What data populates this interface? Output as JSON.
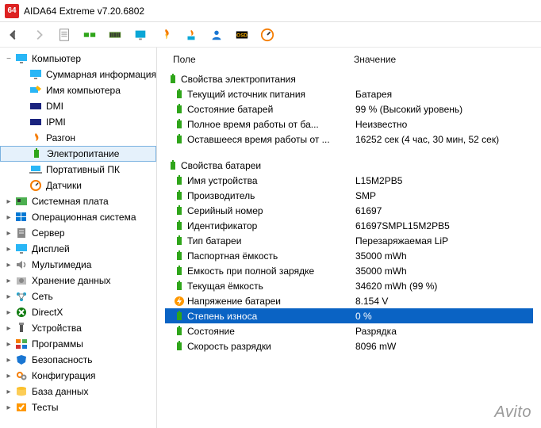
{
  "app": {
    "icon_text": "64",
    "title": "AIDA64 Extreme v7.20.6802"
  },
  "toolbar": {
    "back": "back",
    "forward": "forward",
    "page": "page",
    "chip": "chip",
    "ram": "ram",
    "monitor": "monitor",
    "fire": "fire",
    "temp": "temp",
    "user": "user",
    "osd": "OSD",
    "gauge": "gauge"
  },
  "tree": {
    "root": "Компьютер",
    "computer_children": [
      "Суммарная информация",
      "Имя компьютера",
      "DMI",
      "IPMI",
      "Разгон",
      "Электропитание",
      "Портативный ПК",
      "Датчики"
    ],
    "top_items": [
      "Системная плата",
      "Операционная система",
      "Сервер",
      "Дисплей",
      "Мультимедиа",
      "Хранение данных",
      "Сеть",
      "DirectX",
      "Устройства",
      "Программы",
      "Безопасность",
      "Конфигурация",
      "База данных",
      "Тесты"
    ]
  },
  "columns": {
    "field": "Поле",
    "value": "Значение"
  },
  "groups": {
    "power": "Свойства электропитания",
    "battery": "Свойства батареи"
  },
  "power_rows": [
    {
      "label": "Текущий источник питания",
      "value": "Батарея"
    },
    {
      "label": "Состояние батарей",
      "value": "99 % (Высокий уровень)"
    },
    {
      "label": "Полное время работы от ба...",
      "value": "Неизвестно"
    },
    {
      "label": "Оставшееся время работы от ...",
      "value": "16252 сек (4 час, 30 мин, 52 сек)"
    }
  ],
  "battery_rows": [
    {
      "label": "Имя устройства",
      "value": "L15M2PB5"
    },
    {
      "label": "Производитель",
      "value": "SMP"
    },
    {
      "label": "Серийный номер",
      "value": "61697"
    },
    {
      "label": "Идентификатор",
      "value": "61697SMPL15M2PB5"
    },
    {
      "label": "Тип батареи",
      "value": "Перезаряжаемая LiP"
    },
    {
      "label": "Паспортная ёмкость",
      "value": "35000 mWh"
    },
    {
      "label": "Емкость при полной зарядке",
      "value": "35000 mWh"
    },
    {
      "label": "Текущая ёмкость",
      "value": "34620 mWh  (99 %)"
    },
    {
      "label": "Напряжение батареи",
      "value": "8.154 V",
      "icon": "volt"
    },
    {
      "label": "Степень износа",
      "value": "0 %",
      "selected": true
    },
    {
      "label": "Состояние",
      "value": "Разрядка"
    },
    {
      "label": "Скорость разрядки",
      "value": "8096 mW"
    }
  ],
  "watermark": "Avito"
}
